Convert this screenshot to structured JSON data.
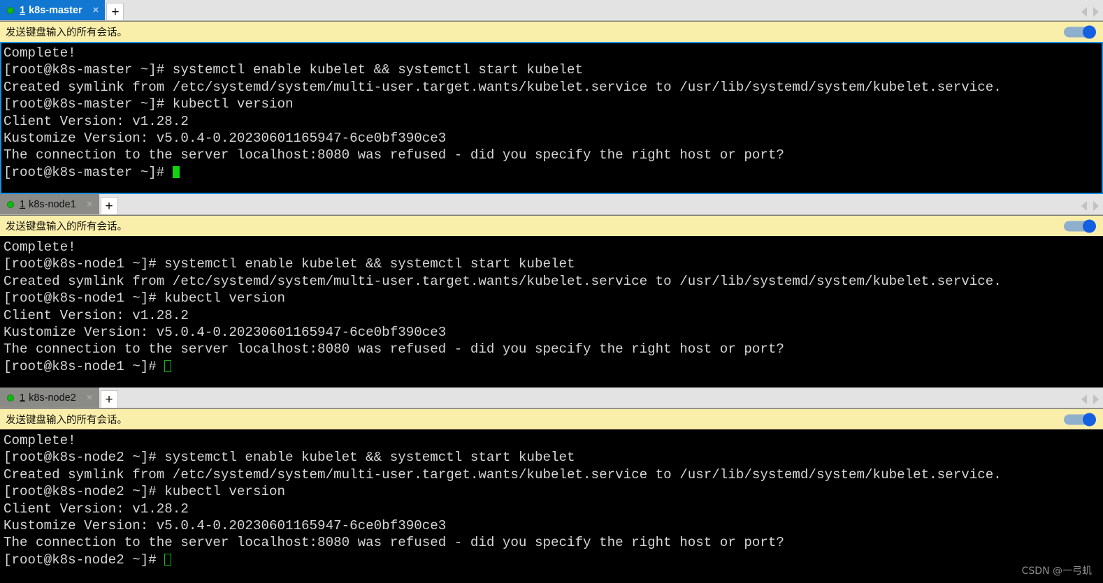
{
  "window": {
    "title": "k8s multi-session terminal"
  },
  "icons": {
    "status_dot": "green-status-dot",
    "close": "×",
    "new_tab": "+",
    "scroll_left": "left-arrow-icon",
    "scroll_right": "right-arrow-icon"
  },
  "colors": {
    "active_tab": "#1177d1",
    "inactive_tab": "#8a8a86",
    "broadcast_bar": "#faeeab",
    "toggle_on": "#1560e0",
    "toggle_track": "#8fb0cd",
    "status_dot": "#12b812",
    "terminal_bg": "#000000",
    "terminal_fg": "#d6d6d6",
    "focus_border": "#1a8fe0",
    "cursor": "#11d411"
  },
  "panels": [
    {
      "tab": {
        "index": "1",
        "title": "k8s-master",
        "active": true,
        "close_label": "×",
        "new_tab_label": "+"
      },
      "broadcast": {
        "text": "发送键盘输入的所有会话。",
        "toggle_on": true
      },
      "terminal": {
        "focused": true,
        "cursor_style": "filled",
        "lines": [
          "Complete!",
          "[root@k8s-master ~]# systemctl enable kubelet && systemctl start kubelet",
          "Created symlink from /etc/systemd/system/multi-user.target.wants/kubelet.service to /usr/lib/systemd/system/kubelet.service.",
          "[root@k8s-master ~]# kubectl version",
          "Client Version: v1.28.2",
          "Kustomize Version: v5.0.4-0.20230601165947-6ce0bf390ce3",
          "The connection to the server localhost:8080 was refused - did you specify the right host or port?"
        ],
        "prompt": "[root@k8s-master ~]# "
      }
    },
    {
      "tab": {
        "index": "1",
        "title": "k8s-node1",
        "active": false,
        "close_label": "×",
        "new_tab_label": "+"
      },
      "broadcast": {
        "text": "发送键盘输入的所有会话。",
        "toggle_on": true
      },
      "terminal": {
        "focused": false,
        "cursor_style": "hollow",
        "lines": [
          "Complete!",
          "[root@k8s-node1 ~]# systemctl enable kubelet && systemctl start kubelet",
          "Created symlink from /etc/systemd/system/multi-user.target.wants/kubelet.service to /usr/lib/systemd/system/kubelet.service.",
          "[root@k8s-node1 ~]# kubectl version",
          "Client Version: v1.28.2",
          "Kustomize Version: v5.0.4-0.20230601165947-6ce0bf390ce3",
          "The connection to the server localhost:8080 was refused - did you specify the right host or port?"
        ],
        "prompt": "[root@k8s-node1 ~]# "
      }
    },
    {
      "tab": {
        "index": "1",
        "title": "k8s-node2",
        "active": false,
        "close_label": "×",
        "new_tab_label": "+"
      },
      "broadcast": {
        "text": "发送键盘输入的所有会话。",
        "toggle_on": true
      },
      "terminal": {
        "focused": false,
        "cursor_style": "hollow",
        "lines": [
          "Complete!",
          "[root@k8s-node2 ~]# systemctl enable kubelet && systemctl start kubelet",
          "Created symlink from /etc/systemd/system/multi-user.target.wants/kubelet.service to /usr/lib/systemd/system/kubelet.service.",
          "[root@k8s-node2 ~]# kubectl version",
          "Client Version: v1.28.2",
          "Kustomize Version: v5.0.4-0.20230601165947-6ce0bf390ce3",
          "The connection to the server localhost:8080 was refused - did you specify the right host or port?"
        ],
        "prompt": "[root@k8s-node2 ~]# "
      }
    }
  ],
  "watermark": "CSDN @一弓虮"
}
